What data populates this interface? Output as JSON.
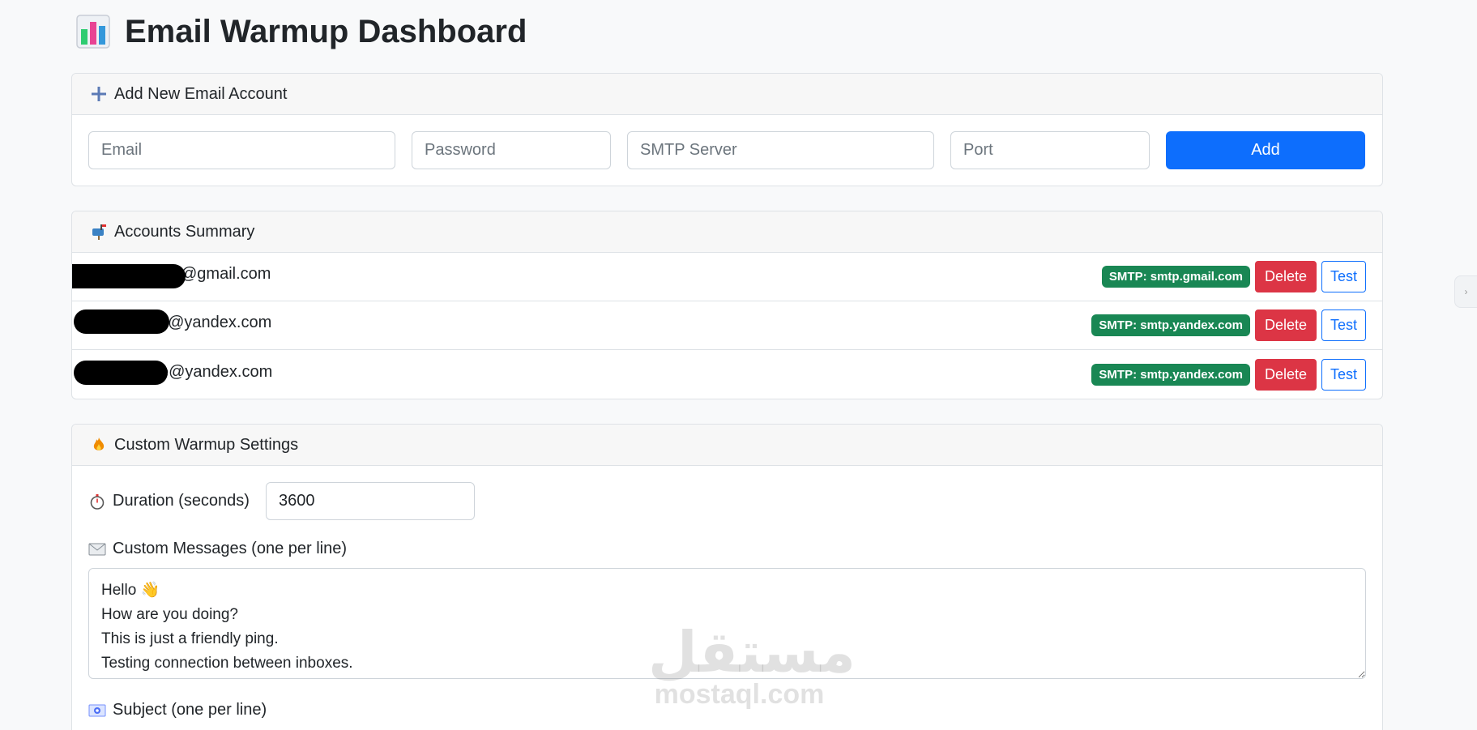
{
  "page": {
    "title": "Email Warmup Dashboard",
    "title_icon": "bar-chart-icon"
  },
  "add_account": {
    "header": "Add New Email Account",
    "header_icon": "plus-icon",
    "email_placeholder": "Email",
    "password_placeholder": "Password",
    "smtp_placeholder": "SMTP Server",
    "port_placeholder": "Port",
    "add_label": "Add"
  },
  "accounts_summary": {
    "header": "Accounts Summary",
    "header_icon": "mailbox-icon",
    "delete_label": "Delete",
    "test_label": "Test",
    "accounts": [
      {
        "email_visible": "@gmail.com",
        "smtp_badge": "SMTP: smtp.gmail.com"
      },
      {
        "email_visible": "u@yandex.com",
        "smtp_badge": "SMTP: smtp.yandex.com"
      },
      {
        "email_visible": "e@yandex.com",
        "smtp_badge": "SMTP: smtp.yandex.com"
      }
    ]
  },
  "warmup_settings": {
    "header": "Custom Warmup Settings",
    "header_icon": "fire-icon",
    "duration_label": "Duration (seconds)",
    "duration_icon": "stopwatch-icon",
    "duration_value": "3600",
    "messages_label": "Custom Messages (one per line)",
    "messages_icon": "envelope-icon",
    "messages_value": "Hello 👋\nHow are you doing?\nThis is just a friendly ping.\nTesting connection between inboxes.",
    "subject_label": "Subject (one per line)",
    "subject_icon": "incoming-envelope-icon"
  },
  "watermark": {
    "arabic": "مستقل",
    "latin": "mostaql.com"
  },
  "colors": {
    "primary": "#0d6efd",
    "danger": "#dc3545",
    "success": "#198754",
    "background": "#f8f9fa"
  }
}
